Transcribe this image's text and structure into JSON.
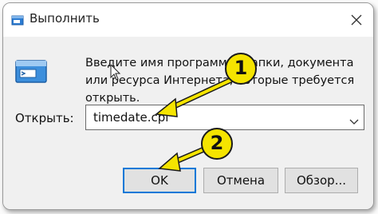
{
  "window": {
    "title": "Выполнить",
    "close_label": "✕"
  },
  "dialog": {
    "description": "Введите имя программы, папки, документа или ресурса Интернета, которые требуется открыть.",
    "open_label": "Открыть:",
    "input_value": "timedate.cpl"
  },
  "buttons": {
    "ok": "OK",
    "cancel": "Отмена",
    "browse": "Обзор..."
  },
  "annotations": {
    "badge1": "1",
    "badge2": "2",
    "badge_color": "#f5e400",
    "arrow_color": "#f5e400"
  },
  "colors": {
    "accent": "#0078d7",
    "window_bg": "#f0f0f0",
    "titlebar_bg": "#ffffff"
  }
}
